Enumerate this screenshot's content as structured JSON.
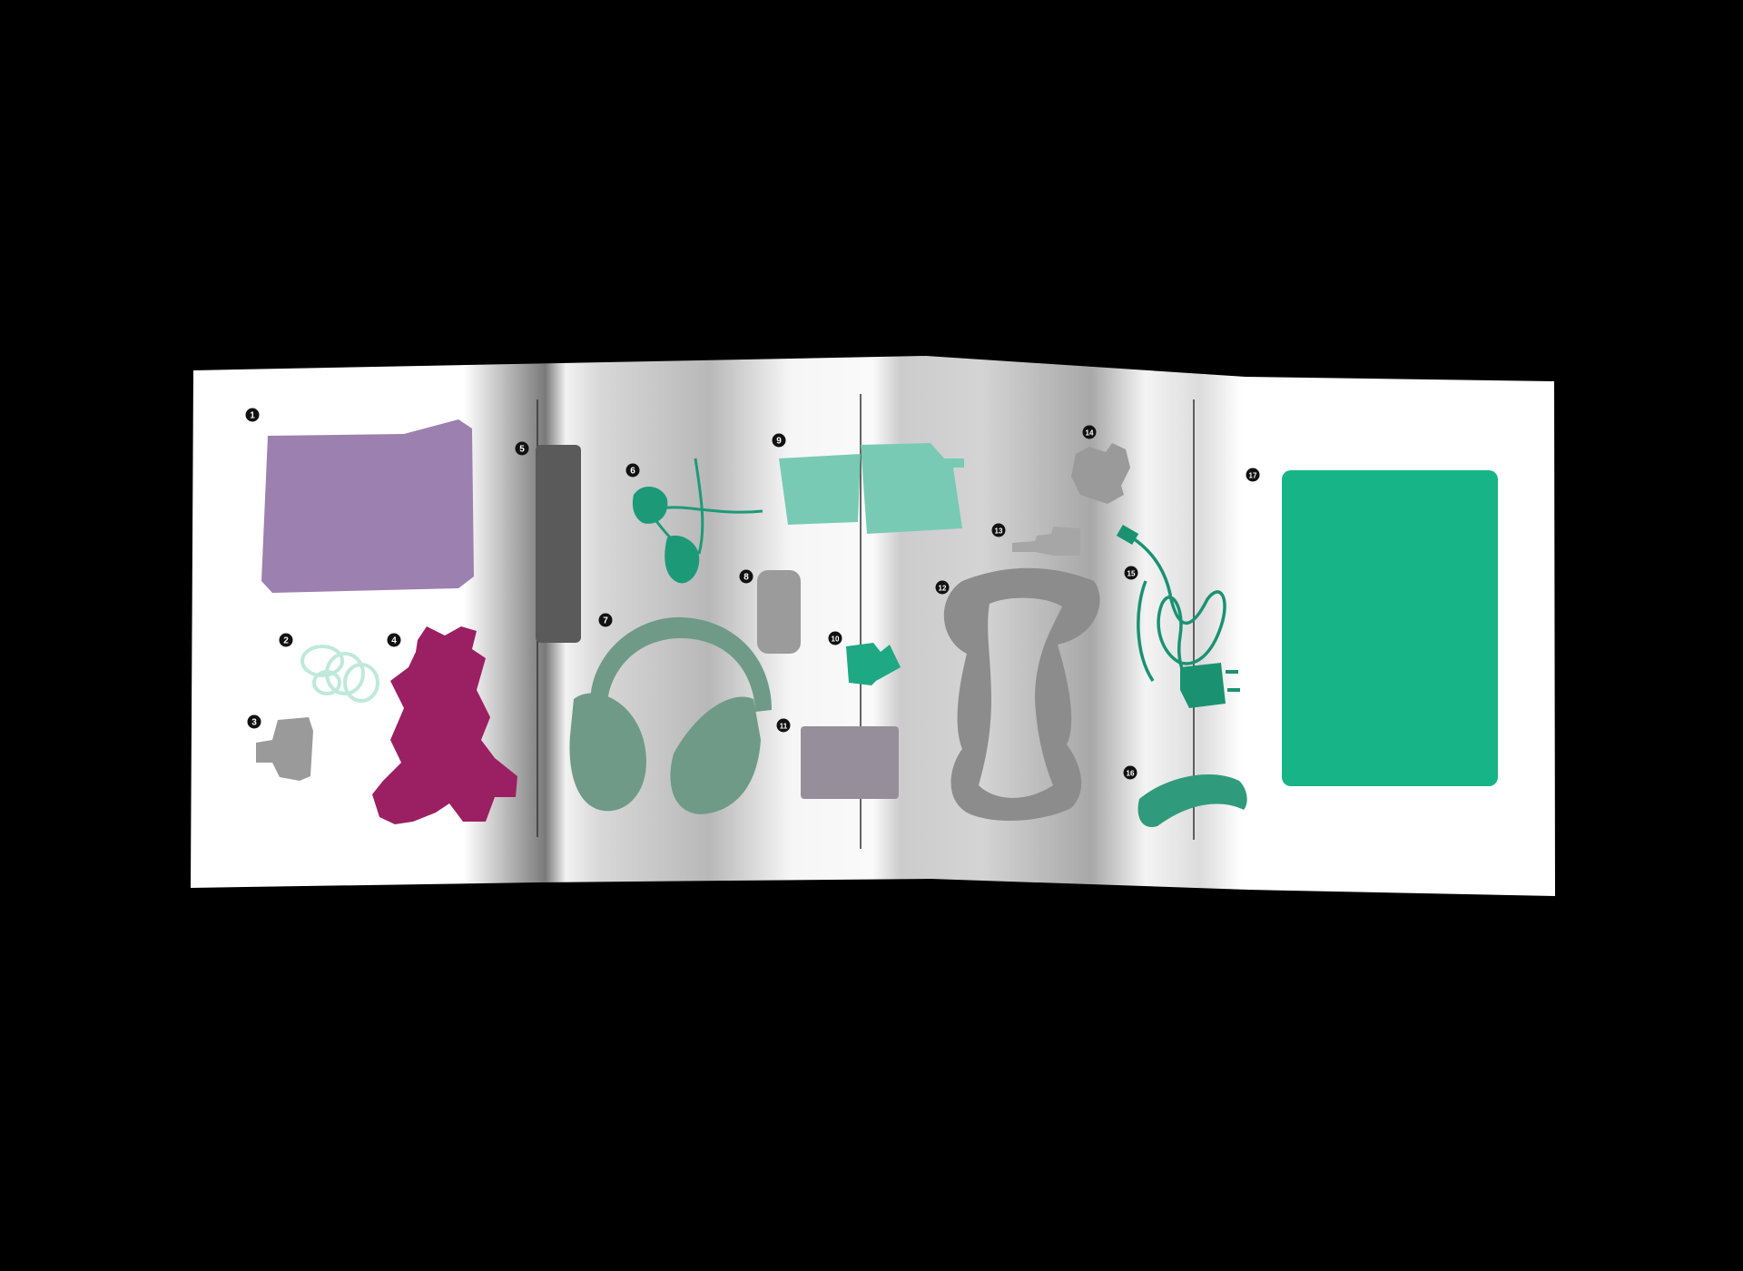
{
  "scene": {
    "background_color": "#000000",
    "paper_color": "#f4f4f4",
    "fold_shadow_color": "#9a9a9a"
  },
  "items": [
    {
      "number": "1",
      "name": "folded-purple-towel-icon",
      "color": "#9c80b0"
    },
    {
      "number": "2",
      "name": "hair-ties-icon",
      "color": "#bfe9da"
    },
    {
      "number": "3",
      "name": "hair-clip-icon",
      "color": "#9a9a9a"
    },
    {
      "number": "4",
      "name": "plush-bunny-icon",
      "color": "#9b1f63"
    },
    {
      "number": "5",
      "name": "pill-organizer-icon",
      "color": "#5a5a5a"
    },
    {
      "number": "6",
      "name": "earphones-icon",
      "color": "#1c9a78"
    },
    {
      "number": "7",
      "name": "headphones-icon",
      "color": "#6f9a88"
    },
    {
      "number": "8",
      "name": "soap-bar-icon",
      "color": "#9b9b9b"
    },
    {
      "number": "9",
      "name": "tumbler-cup-icon",
      "color": "#78cab4"
    },
    {
      "number": "10",
      "name": "usb-adapter-icon",
      "color": "#1fa884"
    },
    {
      "number": "11",
      "name": "folded-cloth-icon",
      "color": "#968e9a"
    },
    {
      "number": "12",
      "name": "sanitary-pad-icon",
      "color": "#8c8c8c"
    },
    {
      "number": "13",
      "name": "small-bottle-icon",
      "color": "#a6a6a6"
    },
    {
      "number": "14",
      "name": "toy-figure-icon",
      "color": "#9a9a9a"
    },
    {
      "number": "15",
      "name": "charger-cable-icon",
      "color": "#1a9272"
    },
    {
      "number": "16",
      "name": "banana-icon",
      "color": "#2f9a7c"
    },
    {
      "number": "17",
      "name": "green-notebook-icon",
      "color": "#17b488"
    }
  ]
}
